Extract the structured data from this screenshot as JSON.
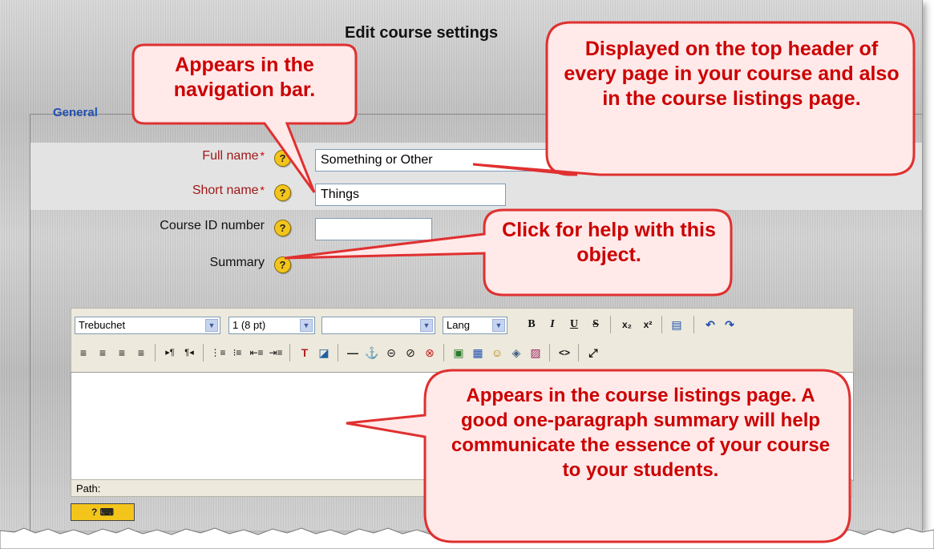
{
  "page": {
    "title": "Edit course settings"
  },
  "form": {
    "legend": "General",
    "fields": {
      "full_name": {
        "label": "Full name",
        "required_mark": "*",
        "value": "Something or Other"
      },
      "short_name": {
        "label": "Short name",
        "required_mark": "*",
        "value": "Things"
      },
      "course_id": {
        "label": "Course ID number",
        "value": ""
      },
      "summary": {
        "label": "Summary"
      }
    },
    "help_glyph": "?"
  },
  "editor": {
    "font_select": "Trebuchet",
    "size_select": "1 (8 pt)",
    "format_select": "",
    "lang_select": "Lang",
    "row1_buttons": [
      "B",
      "I",
      "U",
      "S",
      "x₂",
      "x²",
      "▤",
      "↶",
      "↷"
    ],
    "row2_buttons": [
      "≡",
      "≡",
      "≡",
      "≡",
      "▸¶",
      "¶◂",
      "⋮≡",
      "⁝≡",
      "⇤≡",
      "⇥≡",
      "T",
      "◪",
      "—",
      "⚓",
      "⊝",
      "⊘",
      "⊗",
      "▣",
      "▦",
      "☺",
      "◈",
      "▨",
      "<>",
      "⤢"
    ],
    "path_label": "Path:",
    "keyboard_button": "? ⌨"
  },
  "callouts": {
    "navbar": "Appears in the navigation bar.",
    "header": "Displayed on the top header of every page in your course and also in the course listings page.",
    "help": "Click for help with this object.",
    "summary": "Appears in the course listings page. A good one-paragraph summary will help communicate the essence of your course to your students."
  },
  "colors": {
    "callout_fill": "#ffe9e9",
    "callout_border": "#e03030",
    "callout_text": "#cc0000",
    "legend_blue": "#2050b0",
    "required_red": "#cc0000",
    "help_yellow": "#f3c51b"
  }
}
